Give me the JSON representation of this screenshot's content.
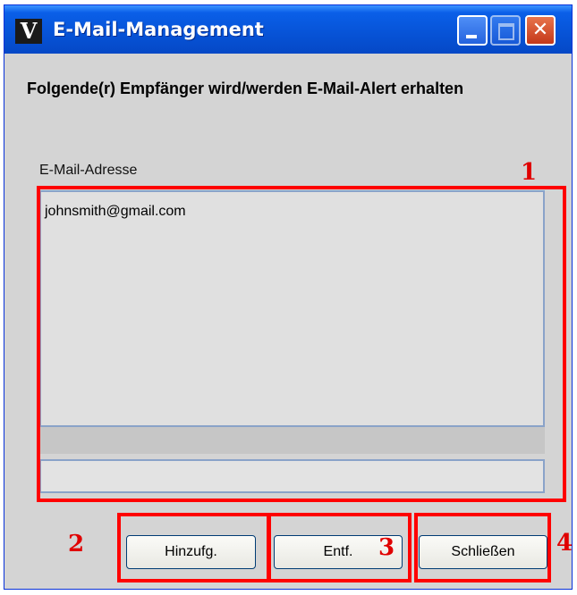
{
  "window": {
    "title": "E-Mail-Management",
    "app_icon": "V",
    "close_glyph": "✕"
  },
  "heading": "Folgende(r) Empfänger wird/werden E-Mail-Alert erhalten",
  "list": {
    "label": "E-Mail-Adresse",
    "items": [
      "johnsmith@gmail.com"
    ]
  },
  "input": {
    "value": ""
  },
  "buttons": {
    "add": "Hinzufg.",
    "remove": "Entf.",
    "close": "Schließen"
  },
  "annotations": {
    "list_box": "1",
    "add": "2",
    "remove": "3",
    "close": "4",
    "color": "#ff0000"
  }
}
